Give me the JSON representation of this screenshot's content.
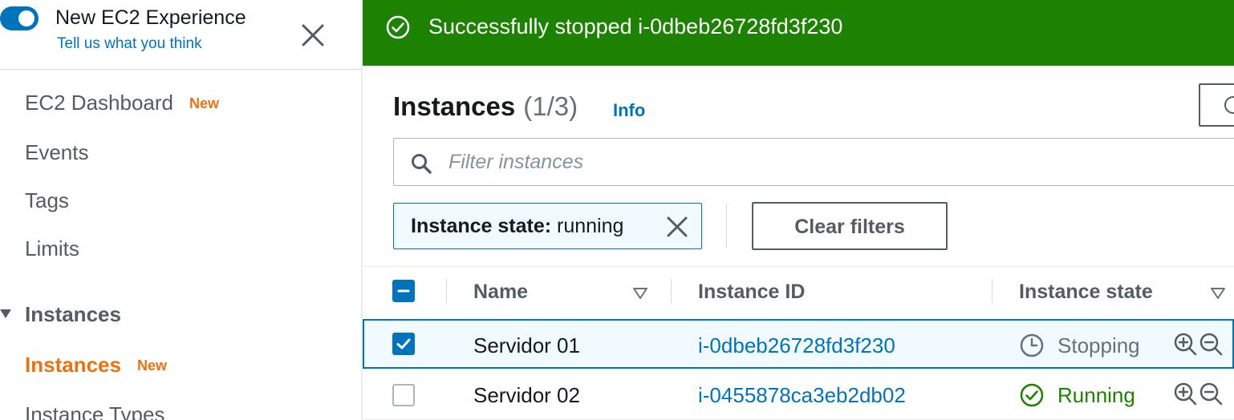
{
  "sidebar": {
    "experience_title": "New EC2 Experience",
    "feedback_link": "Tell us what you think",
    "nav": {
      "dashboard": "EC2 Dashboard",
      "dashboard_badge": "New",
      "events": "Events",
      "tags": "Tags",
      "limits": "Limits",
      "section_instances": "Instances",
      "instances": "Instances",
      "instances_badge": "New",
      "instance_types": "Instance Types"
    }
  },
  "flash": {
    "message": "Successfully stopped i-0dbeb26728fd3f230",
    "color": "#1d8102"
  },
  "main": {
    "title": "Instances",
    "count": "(1/3)",
    "info_link": "Info",
    "search_placeholder": "Filter instances",
    "filter_token": {
      "key": "Instance state:",
      "value": "running"
    },
    "clear_filters": "Clear filters"
  },
  "table": {
    "columns": [
      "Name",
      "Instance ID",
      "Instance state"
    ],
    "rows": [
      {
        "selected": true,
        "name": "Servidor 01",
        "instance_id": "i-0dbeb26728fd3f230",
        "state": "Stopping"
      },
      {
        "selected": false,
        "name": "Servidor 02",
        "instance_id": "i-0455878ca3eb2db02",
        "state": "Running"
      }
    ]
  },
  "colors": {
    "link": "#0073bb",
    "accent": "#ec7211",
    "success": "#1d8102",
    "muted": "#687078"
  }
}
